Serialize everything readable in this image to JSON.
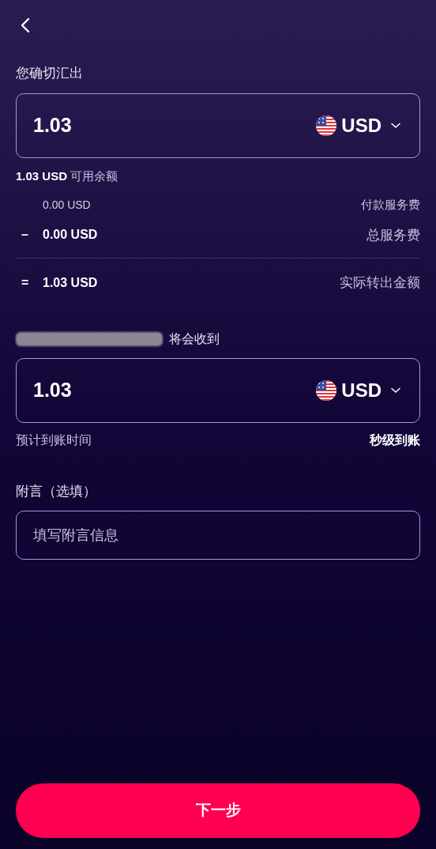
{
  "send": {
    "label": "您确切汇出",
    "amount": "1.03",
    "currency": "USD",
    "balance_amount": "1.03 USD",
    "balance_label": "可用余额"
  },
  "fees": [
    {
      "kind": "detail",
      "amount": "0.00 USD",
      "label": "付款服务费"
    },
    {
      "kind": "summary",
      "sign": "–",
      "amount": "0.00 USD",
      "label": "总服务费"
    }
  ],
  "total": {
    "sign": "=",
    "amount": "1.03 USD",
    "label": "实际转出金额"
  },
  "receive": {
    "label": "将会收到",
    "amount": "1.03",
    "currency": "USD",
    "eta_label": "预计到账时间",
    "eta_value": "秒级到账"
  },
  "memo": {
    "label": "附言（选填）",
    "placeholder": "填写附言信息"
  },
  "next_button": "下一步"
}
